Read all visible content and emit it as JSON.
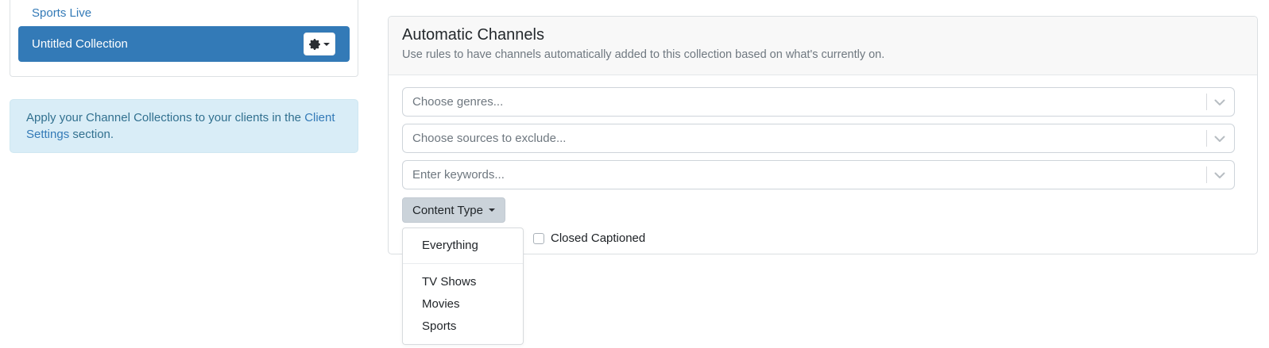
{
  "sidebar": {
    "items": [
      {
        "label": "Sports Live",
        "active": false
      },
      {
        "label": "Untitled Collection",
        "active": true
      }
    ]
  },
  "alert": {
    "text_before": "Apply your Channel Collections to your clients in the ",
    "link_label": "Client Settings",
    "text_after": " section."
  },
  "automatic_channels": {
    "title": "Automatic Channels",
    "subtitle": "Use rules to have channels automatically added to this collection based on what's currently on.",
    "genre_input": {
      "value": "",
      "placeholder": "Choose genres..."
    },
    "sources_input": {
      "value": "",
      "placeholder": "Choose sources to exclude..."
    },
    "keywords_input": {
      "value": "",
      "placeholder": "Enter keywords..."
    },
    "content_type": {
      "button_label": "Content Type",
      "open": true,
      "menu_items": [
        "Everything",
        "TV Shows",
        "Movies",
        "Sports"
      ]
    },
    "closed_captioned": {
      "label": "Closed Captioned",
      "checked": false
    }
  },
  "icons": {
    "gear": "gear-icon",
    "caret_down": "caret-down-icon",
    "chevron_down": "chevron-down-icon"
  },
  "colors": {
    "accent_blue": "#337ab7",
    "active_item_bg": "#337ab7",
    "alert_bg": "#d9edf7",
    "alert_text": "#31708f",
    "content_type_button_bg": "#cbd3da",
    "card_header_bg": "#f8f8f8"
  }
}
